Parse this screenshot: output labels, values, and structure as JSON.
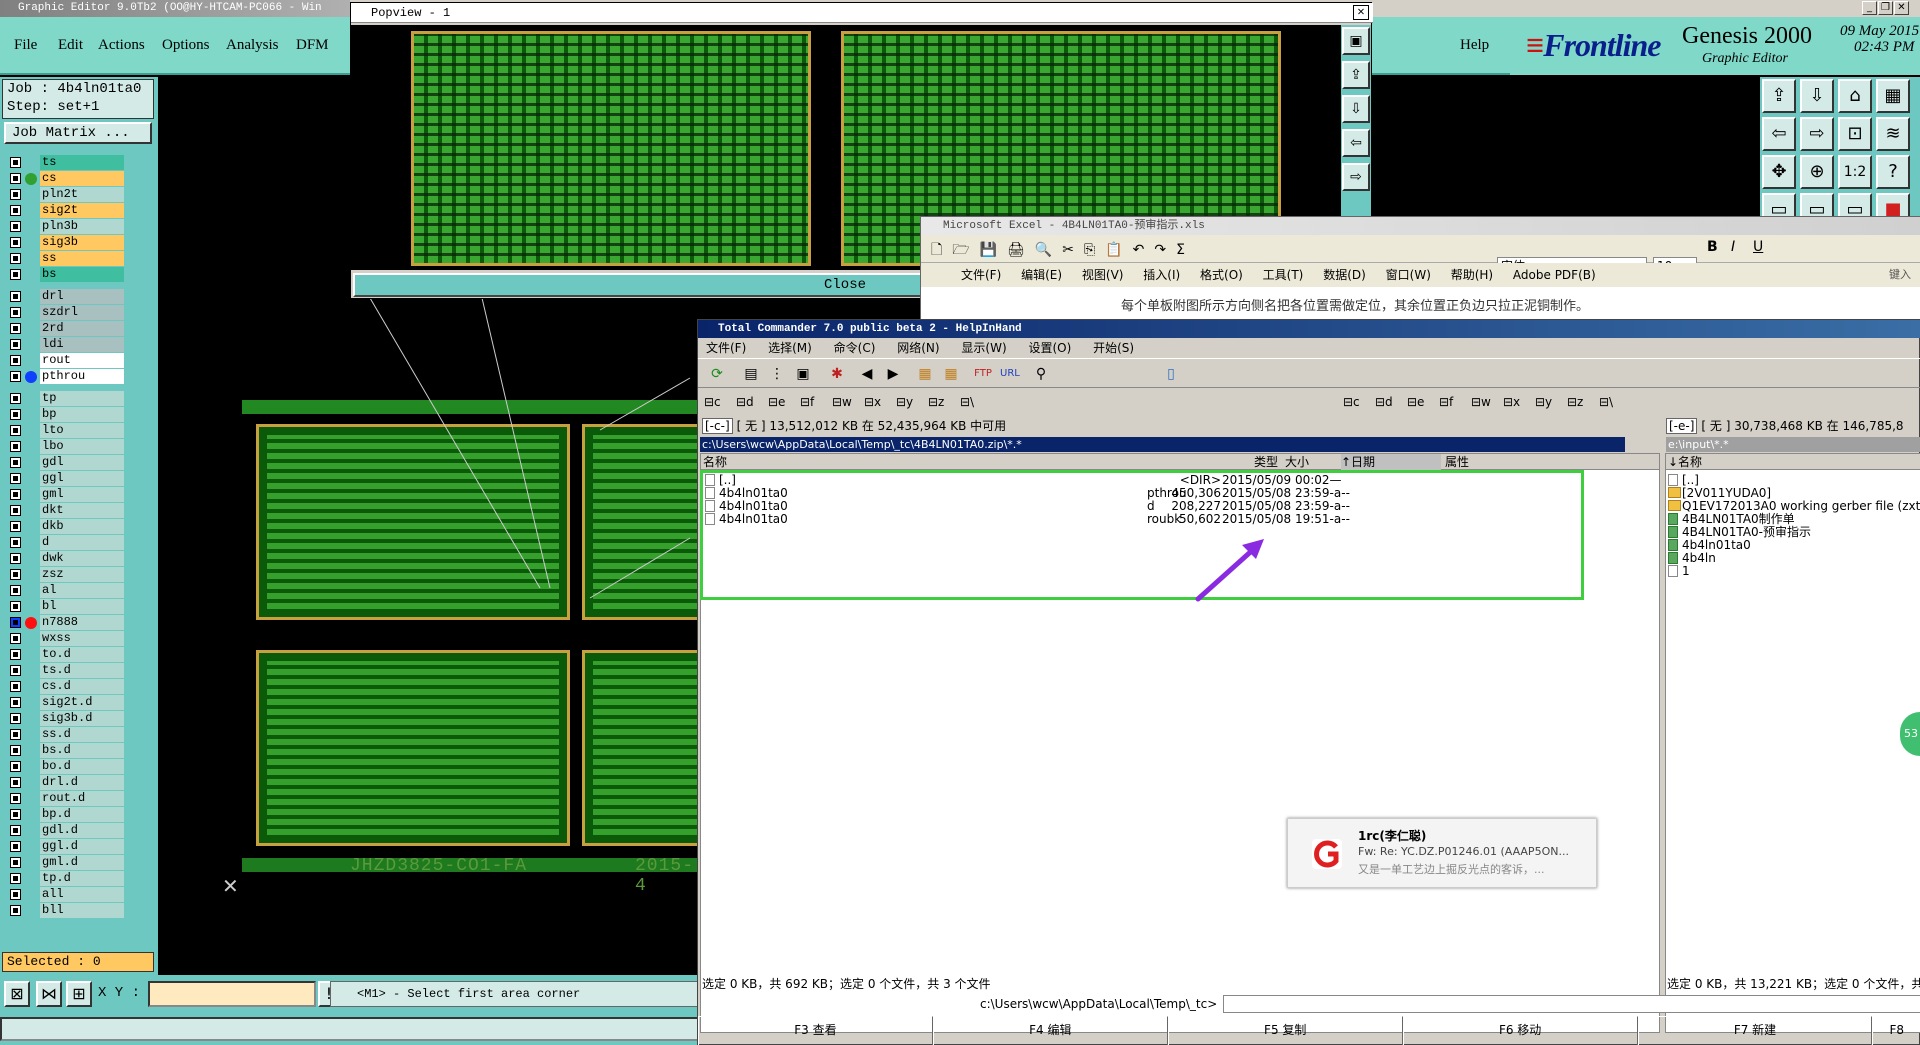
{
  "genesis": {
    "title": "Graphic Editor 9.0Tb2  (OO@HY-HTCAM-PC066 - Win",
    "menu": [
      "File",
      "Edit",
      "Actions",
      "Options",
      "Analysis",
      "DFM"
    ],
    "help": "Help",
    "brand": {
      "logo_main": "Frontline",
      "product": "Genesis 2000",
      "subtitle": "Graphic Editor",
      "date": "09 May 2015",
      "time": "02:43 PM"
    },
    "job": "Job : 4b4ln01ta0",
    "step": "Step: set+1",
    "job_matrix": "Job Matrix ...",
    "layers_group1": [
      {
        "name": "ts",
        "color": "#3fbf9f"
      },
      {
        "name": "cs",
        "color": "#ffc860",
        "dot": "#30a030"
      },
      {
        "name": "pln2t",
        "color": "#b0d8d0"
      },
      {
        "name": "sig2t",
        "color": "#ffc860"
      },
      {
        "name": "pln3b",
        "color": "#b0d8d0"
      },
      {
        "name": "sig3b",
        "color": "#ffc860"
      },
      {
        "name": "ss",
        "color": "#ffc860"
      },
      {
        "name": "bs",
        "color": "#3fbf9f"
      }
    ],
    "layers_group2": [
      {
        "name": "drl",
        "color": "#a8c0c0"
      },
      {
        "name": "szdrl",
        "color": "#a8c0c0"
      },
      {
        "name": "2rd",
        "color": "#a8c0c0"
      },
      {
        "name": "ldi",
        "color": "#a8c0c0"
      },
      {
        "name": "rout",
        "color": "#ffffff"
      },
      {
        "name": "pthrou",
        "color": "#ffffff",
        "dot": "#1040ff"
      }
    ],
    "layers_group3": [
      {
        "name": "tp"
      },
      {
        "name": "bp"
      },
      {
        "name": "lto"
      },
      {
        "name": "lbo"
      },
      {
        "name": "gdl"
      },
      {
        "name": "ggl"
      },
      {
        "name": "gml"
      },
      {
        "name": "dkt"
      },
      {
        "name": "dkb"
      },
      {
        "name": "d"
      },
      {
        "name": "dwk"
      },
      {
        "name": "zsz"
      },
      {
        "name": "al"
      },
      {
        "name": "bl"
      },
      {
        "name": "n7888",
        "dot": "#ff1010",
        "selected": true
      },
      {
        "name": "wxss"
      },
      {
        "name": "to.d"
      },
      {
        "name": "ts.d"
      },
      {
        "name": "cs.d"
      },
      {
        "name": "sig2t.d"
      },
      {
        "name": "sig3b.d"
      },
      {
        "name": "ss.d"
      },
      {
        "name": "bs.d"
      },
      {
        "name": "bo.d"
      },
      {
        "name": "drl.d"
      },
      {
        "name": "rout.d"
      },
      {
        "name": "bp.d"
      },
      {
        "name": "gdl.d"
      },
      {
        "name": "ggl.d"
      },
      {
        "name": "gml.d"
      },
      {
        "name": "tp.d"
      },
      {
        "name": "all"
      },
      {
        "name": "bll"
      }
    ],
    "selected": "Selected : 0",
    "xy_label": "X Y :",
    "status_msg": "<M1> - Select first area corner",
    "pcb_label_1": "JHZD3825-CO1-FA",
    "pcb_label_2": "2015-4"
  },
  "popview": {
    "title": "Popview - 1",
    "close": "Close"
  },
  "excel": {
    "title": "Microsoft Excel - 4B4LN01TA0-预审指示.xls",
    "menu": [
      "文件(F)",
      "编辑(E)",
      "视图(V)",
      "插入(I)",
      "格式(O)",
      "工具(T)",
      "数据(D)",
      "窗口(W)",
      "帮助(H)",
      "Adobe PDF(B)"
    ],
    "font": "宋体",
    "size": "10",
    "cell_text": "每个单板附图所示方向侧名把各位置需做定位，其余位置正负边只拉正泥铜制作。",
    "right_text": "键入"
  },
  "tc": {
    "title": "Total Commander 7.0 public beta 2 - HelpInHand",
    "menu": [
      "文件(F)",
      "选择(M)",
      "命令(C)",
      "网络(N)",
      "显示(W)",
      "设置(O)",
      "开始(S)"
    ],
    "drives_left": [
      "c",
      "d",
      "e",
      "f",
      "w",
      "x",
      "y",
      "z",
      "\\"
    ],
    "drives_right": [
      "c",
      "d",
      "e",
      "f",
      "w",
      "x",
      "y",
      "z",
      "\\"
    ],
    "left_drive": "[-c-]",
    "left_free": "[ 无 ] 13,512,012 KB 在 52,435,964 KB 中可用",
    "right_drive": "[-e-]",
    "right_free": "[ 无 ] 30,738,468 KB 在 146,785,8",
    "left_path": "c:\\Users\\wcw\\AppData\\Local\\Temp\\_tc\\4B4LN01TA0.zip\\*.*",
    "right_path": "e:\\input\\*.*",
    "headers": {
      "name": "名称",
      "type": "类型",
      "size": "大小",
      "date": "↑日期",
      "attr": "属性"
    },
    "files": [
      {
        "name": "[..]",
        "type": "",
        "size": "<DIR>",
        "date": "2015/05/09 00:02—"
      },
      {
        "name": "4b4ln01ta0",
        "type": "pthrou",
        "size": "450,306",
        "date": "2015/05/08 23:59-a--"
      },
      {
        "name": "4b4ln01ta0",
        "type": "d",
        "size": "208,227",
        "date": "2015/05/08 23:59-a--"
      },
      {
        "name": "4b4ln01ta0",
        "type": "roubk",
        "size": "50,602",
        "date": "2015/05/08 19:51-a--"
      }
    ],
    "right_header": "↓名称",
    "right_files": [
      {
        "name": "[..]",
        "kind": "up"
      },
      {
        "name": "[2V011YUDA0]",
        "kind": "dir"
      },
      {
        "name": "Q1EV172013A0 working gerber file (zxt)",
        "kind": "dir"
      },
      {
        "name": "4B4LN01TA0制作单",
        "kind": "xls"
      },
      {
        "name": "4B4LN01TA0-预审指示",
        "kind": "xls"
      },
      {
        "name": "4b4ln01ta0",
        "kind": "xls"
      },
      {
        "name": "4b4ln",
        "kind": "xls"
      },
      {
        "name": "1",
        "kind": "file"
      }
    ],
    "status_left": "选定 0 KB，共 692 KB；选定 0 个文件，共 3 个文件",
    "status_right": "选定 0 KB，共 13,221 KB；选定 0 个文件，共",
    "cmd_path": "c:\\Users\\wcw\\AppData\\Local\\Temp\\_tc>",
    "fkeys": [
      "F3 查看",
      "F4 编辑",
      "F5 复制",
      "F6 移动",
      "F7 新建",
      "F8"
    ]
  },
  "notification": {
    "sender": "1rc(李仁聪)",
    "subject": "Fw: Re: YC.DZ.P01246.01 (AAAP5ON...",
    "preview": "又是一单工艺边上掘反光点的客诉，...",
    "accent": "#e02020"
  },
  "bubble_text": "53"
}
